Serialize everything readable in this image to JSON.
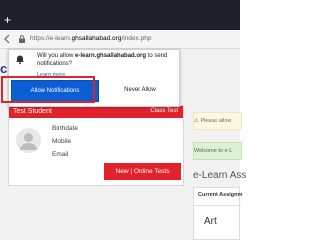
{
  "browser": {
    "new_tab_glyph": "+",
    "url_prefix": "https://e-learn.",
    "url_domain": "ghsallahabad.org",
    "url_suffix": "/index.php",
    "icons": [
      "plus-icon",
      "back-arrow-icon",
      "padlock-icon"
    ]
  },
  "site": {
    "logo_fragment": "ch"
  },
  "notification_prompt": {
    "question_prefix": "Will you allow ",
    "question_domain": "e-learn.ghsallahabad.org",
    "question_suffix": " to send notifications?",
    "learn_more": "Learn more",
    "allow_label": "Allow Notifications",
    "never_label": "Never Allow",
    "icon": "bell-icon"
  },
  "student_card": {
    "name": "Test Student",
    "class_label": "Class Test",
    "birthdate_label": "Birthdate",
    "mobile_label": "Mobile",
    "email_label": "Email",
    "new_tests_label": "New | Online Tests",
    "avatar_icon": "user-avatar-icon"
  },
  "side": {
    "alert_yellow": "Please allow",
    "alert_green": "Welcome to e-L",
    "title": "e-Learn Ass",
    "panel_heading": "Current Assignm",
    "subject": "Art"
  },
  "colors": {
    "accent_red": "#e2232c",
    "allow_blue": "#0b5fd2",
    "highlight_red": "#e2222a",
    "tabbar": "#1f1f2b"
  }
}
